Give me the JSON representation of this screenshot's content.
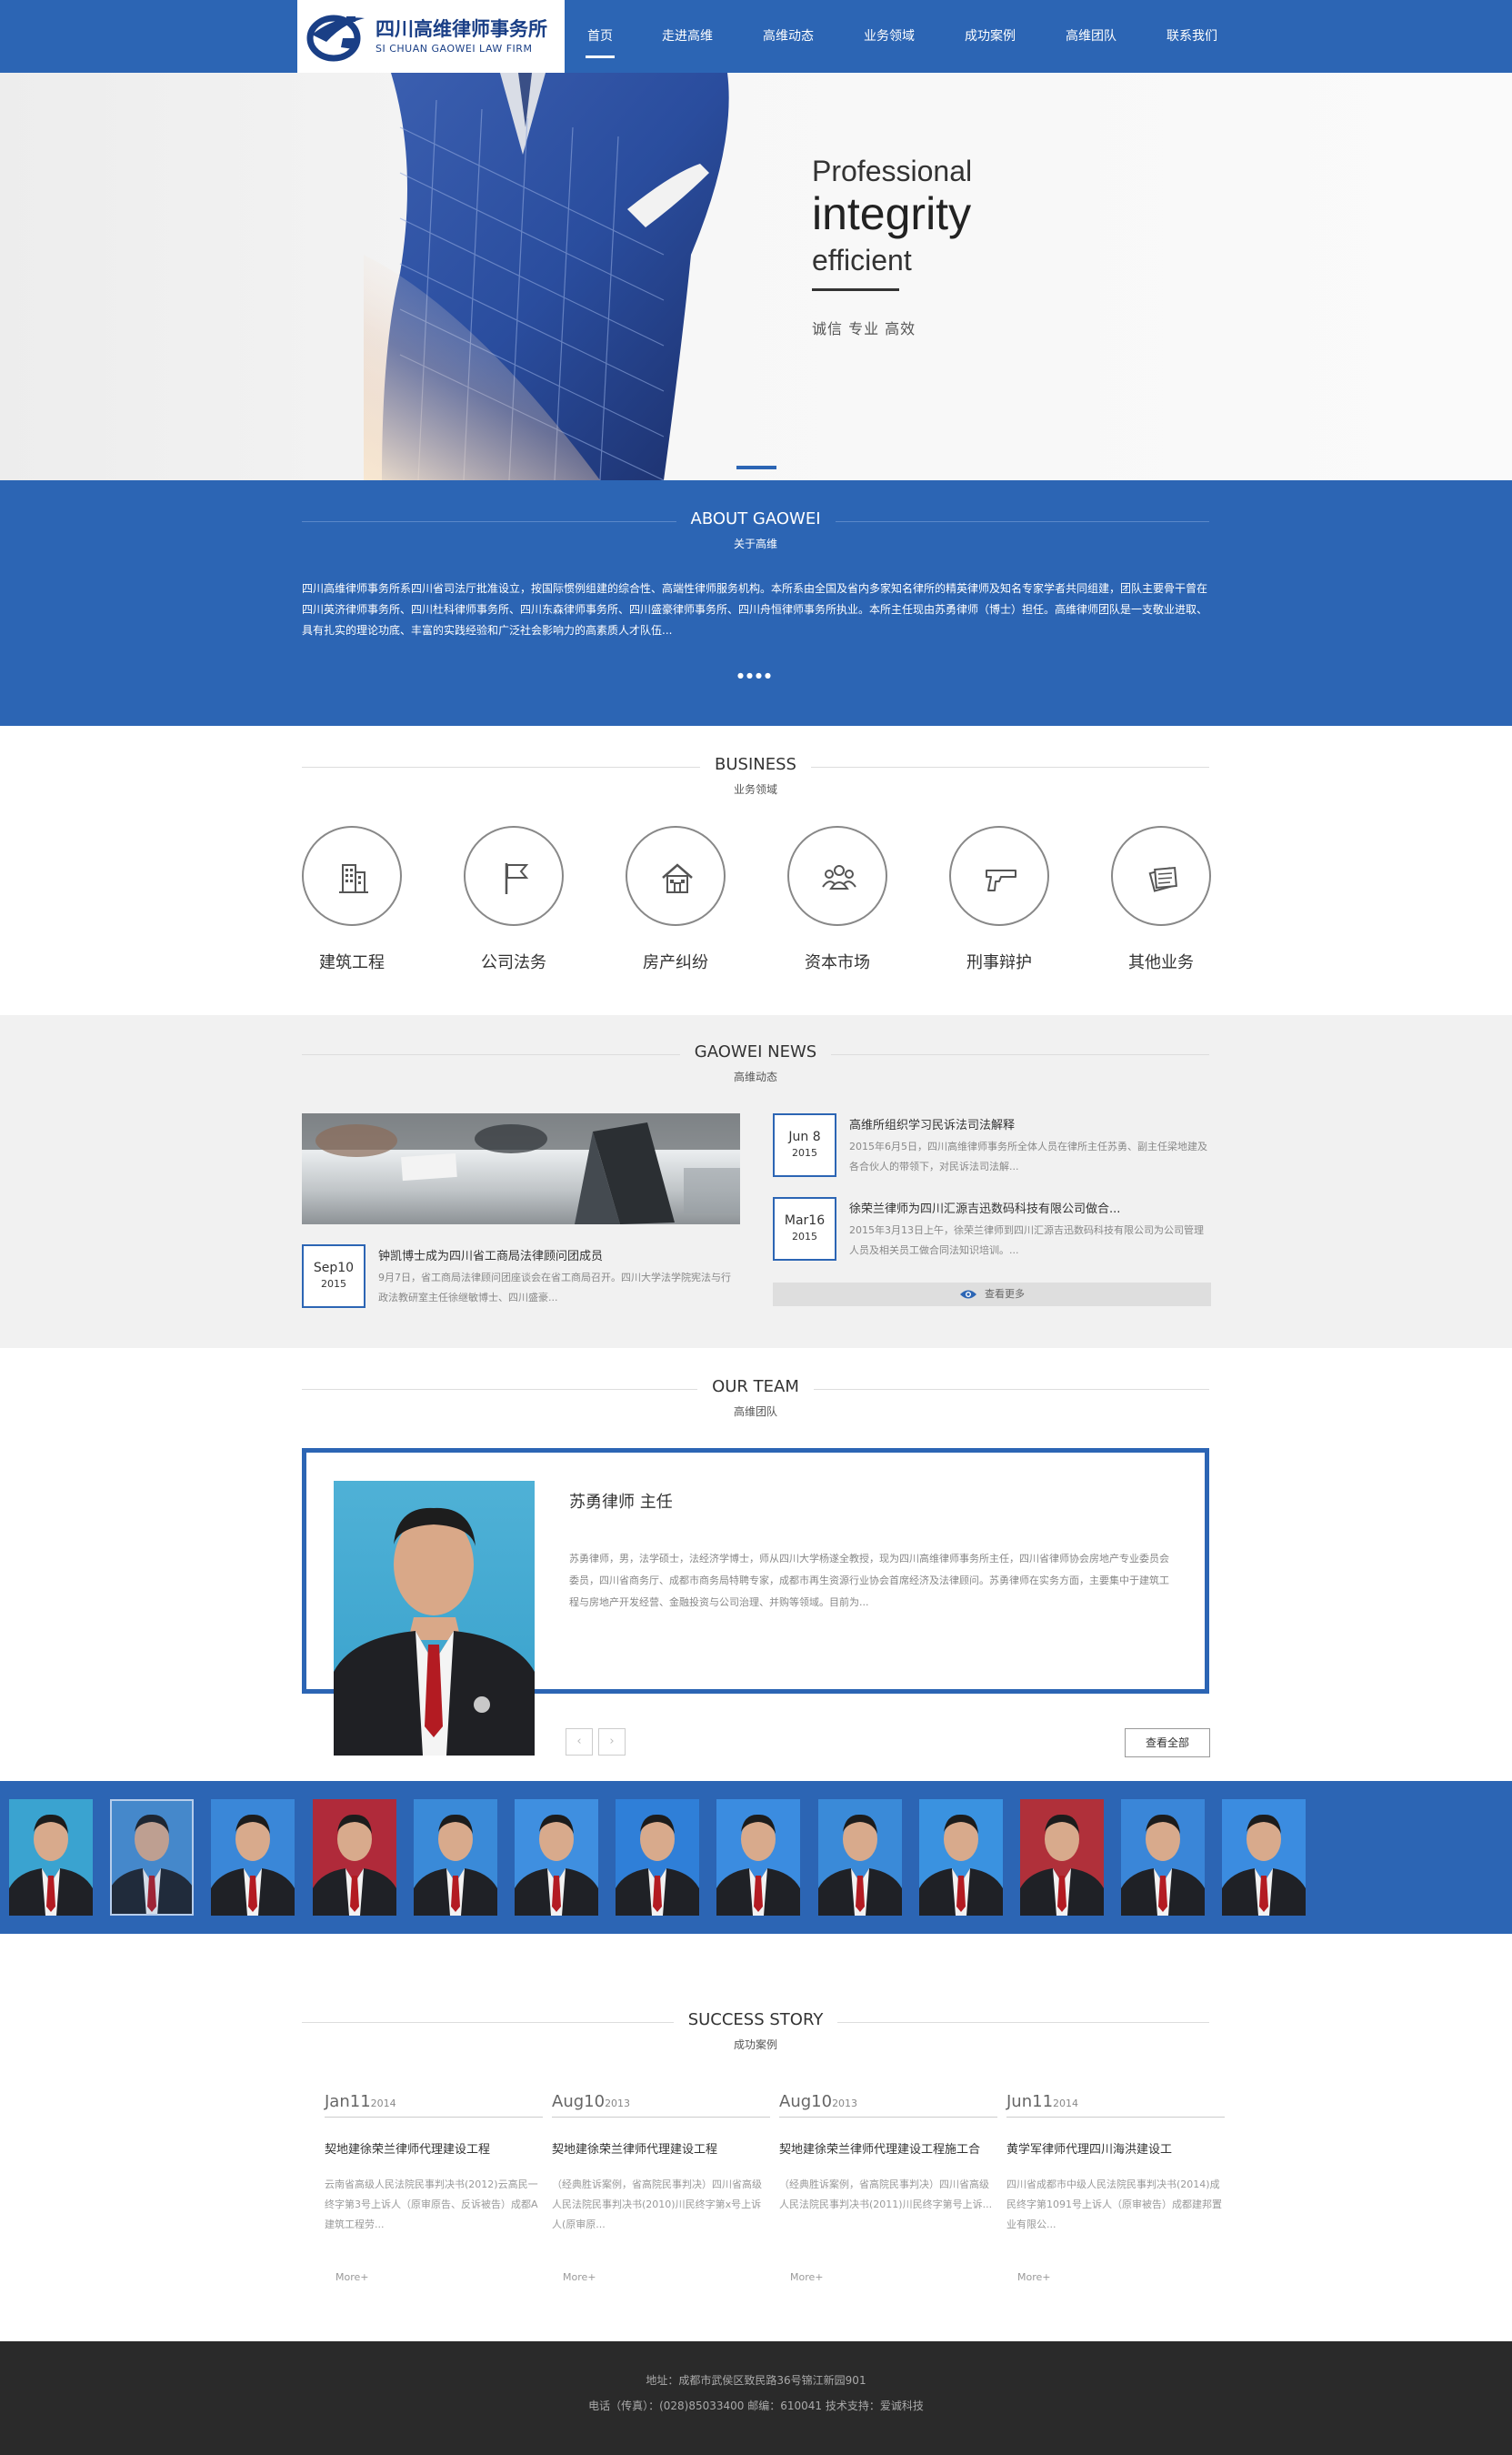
{
  "header": {
    "logo_cn": "四川高维律师事务所",
    "logo_en": "SI CHUAN GAOWEI LAW FIRM",
    "nav": [
      "首页",
      "走进高维",
      "高维动态",
      "业务领域",
      "成功案例",
      "高维团队",
      "联系我们"
    ],
    "active_index": 0
  },
  "banner": {
    "line1": "Professional",
    "line2": "integrity",
    "line3": "efficient",
    "sub": "诚信  专业  高效"
  },
  "about": {
    "title_en": "ABOUT GAOWEI",
    "title_cn": "关于高维",
    "text": "四川高维律师事务所系四川省司法厅批准设立，按国际惯例组建的综合性、高端性律师服务机构。本所系由全国及省内多家知名律所的精英律师及知名专家学者共同组建，团队主要骨干曾在四川英济律师事务所、四川杜科律师事务所、四川东森律师事务所、四川盛豪律师事务所、四川舟恒律师事务所执业。本所主任现由苏勇律师（博士）担任。高维律师团队是一支敬业进取、具有扎实的理论功底、丰富的实践经验和广泛社会影响力的高素质人才队伍...",
    "dots": "●●●●"
  },
  "business": {
    "title_en": "BUSINESS",
    "title_cn": "业务领域",
    "items": [
      {
        "label": "建筑工程",
        "icon": "building-icon"
      },
      {
        "label": "公司法务",
        "icon": "flag-icon"
      },
      {
        "label": "房产纠纷",
        "icon": "house-icon"
      },
      {
        "label": "资本市场",
        "icon": "people-icon"
      },
      {
        "label": "刑事辩护",
        "icon": "gun-icon"
      },
      {
        "label": "其他业务",
        "icon": "documents-icon"
      }
    ]
  },
  "news": {
    "title_en": "GAOWEI NEWS",
    "title_cn": "高维动态",
    "main": {
      "date": "Sep10",
      "year": "2015",
      "title": "钟凯博士成为四川省工商局法律顾问团成员",
      "desc": "9月7日，省工商局法律顾问团座谈会在省工商局召开。四川大学法学院宪法与行政法教研室主任徐继敏博士、四川盛豪..."
    },
    "items": [
      {
        "date": "Jun 8",
        "year": "2015",
        "title": "高维所组织学习民诉法司法解释",
        "desc": "2015年6月5日，四川高维律师事务所全体人员在律所主任苏勇、副主任梁地建及各合伙人的带领下，对民诉法司法解..."
      },
      {
        "date": "Mar16",
        "year": "2015",
        "title": "徐荣兰律师为四川汇源吉迅数码科技有限公司做合...",
        "desc": "2015年3月13日上午，徐荣兰律师到四川汇源吉迅数码科技有限公司为公司管理人员及相关员工做合同法知识培训。..."
      }
    ],
    "more": "查看更多"
  },
  "team": {
    "title_en": "OUR TEAM",
    "title_cn": "高维团队",
    "name": "苏勇律师 主任",
    "desc": "苏勇律师，男，法学硕士，法经济学博士，师从四川大学杨遂全教授，现为四川高维律师事务所主任，四川省律师协会房地产专业委员会委员，四川省商务厅、成都市商务局特聘专家，成都市再生资源行业协会首席经济及法律顾问。苏勇律师在实务方面，主要集中于建筑工程与房地产开发经营、金融投资与公司治理、并购等领域。目前为...",
    "prev": "‹",
    "next": "›",
    "view_all": "查看全部",
    "thumb_count": 13,
    "selected_thumb": 1
  },
  "success": {
    "title_en": "SUCCESS STORY",
    "title_cn": "成功案例",
    "items": [
      {
        "date": "Jan11",
        "year": "2014",
        "title": "契地建徐荣兰律师代理建设工程",
        "desc": "云南省高级人民法院民事判决书(2012)云高民一终字第3号上诉人（原审原告、反诉被告）成都A建筑工程劳...",
        "more": "More+"
      },
      {
        "date": "Aug10",
        "year": "2013",
        "title": "契地建徐荣兰律师代理建设工程",
        "desc": "（经典胜诉案例，省高院民事判决）四川省高级人民法院民事判决书(2010)川民终字第x号上诉人(原审原...",
        "more": "More+"
      },
      {
        "date": "Aug10",
        "year": "2013",
        "title": "契地建徐荣兰律师代理建设工程施工合",
        "desc": "（经典胜诉案例，省高院民事判决）四川省高级人民法院民事判决书(2011)川民终字第号上诉...",
        "more": "More+"
      },
      {
        "date": "Jun11",
        "year": "2014",
        "title": "黄学军律师代理四川海洪建设工",
        "desc": "四川省成都市中级人民法院民事判决书(2014)成民终字第1091号上诉人（原审被告）成都建邦置业有限公...",
        "more": "More+"
      }
    ]
  },
  "footer": {
    "line1": "地址：成都市武侯区致民路36号锦江新园901",
    "line2": "电话（传真）：(028)85033400 邮编：610041 技术支持：爱诚科技"
  },
  "colors": {
    "brand": "#2c65b4",
    "footer_bg": "#2a2a2a",
    "news_bg": "#f1f1f1"
  }
}
